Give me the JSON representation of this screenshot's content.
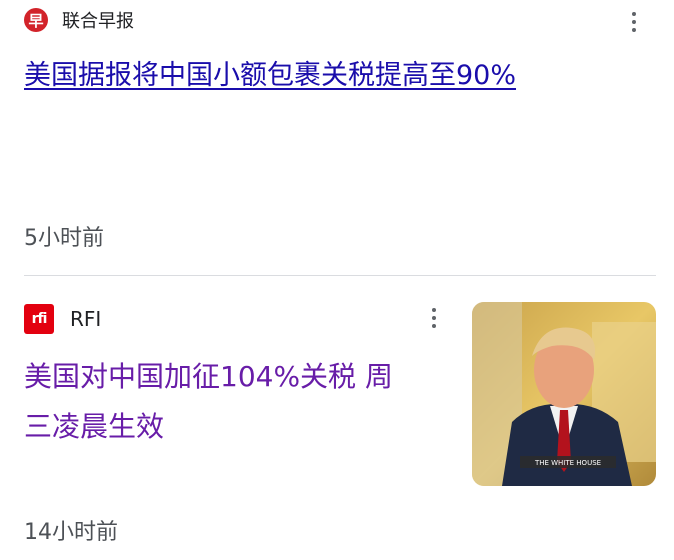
{
  "articles": [
    {
      "source": "联合早报",
      "headline": "美国据报将中国小额包裹关税提高至90%",
      "time": "5小时前",
      "logo_glyph": "早",
      "logo_color": "#d2232a"
    },
    {
      "source": "RFI",
      "headline_line1": "美国对中国加征104%关税 周",
      "headline_line2": "三凌晨生效",
      "time": "14小时前",
      "logo_glyph": "rfi",
      "logo_color": "#e3000f",
      "thumbnail_caption": "THE WHITE HOUSE"
    }
  ],
  "colors": {
    "link_unvisited": "#1a0dab",
    "link_visited": "#681da8",
    "meta_text": "#4d5156"
  },
  "icons": {
    "more_options": "more-vert-icon"
  }
}
